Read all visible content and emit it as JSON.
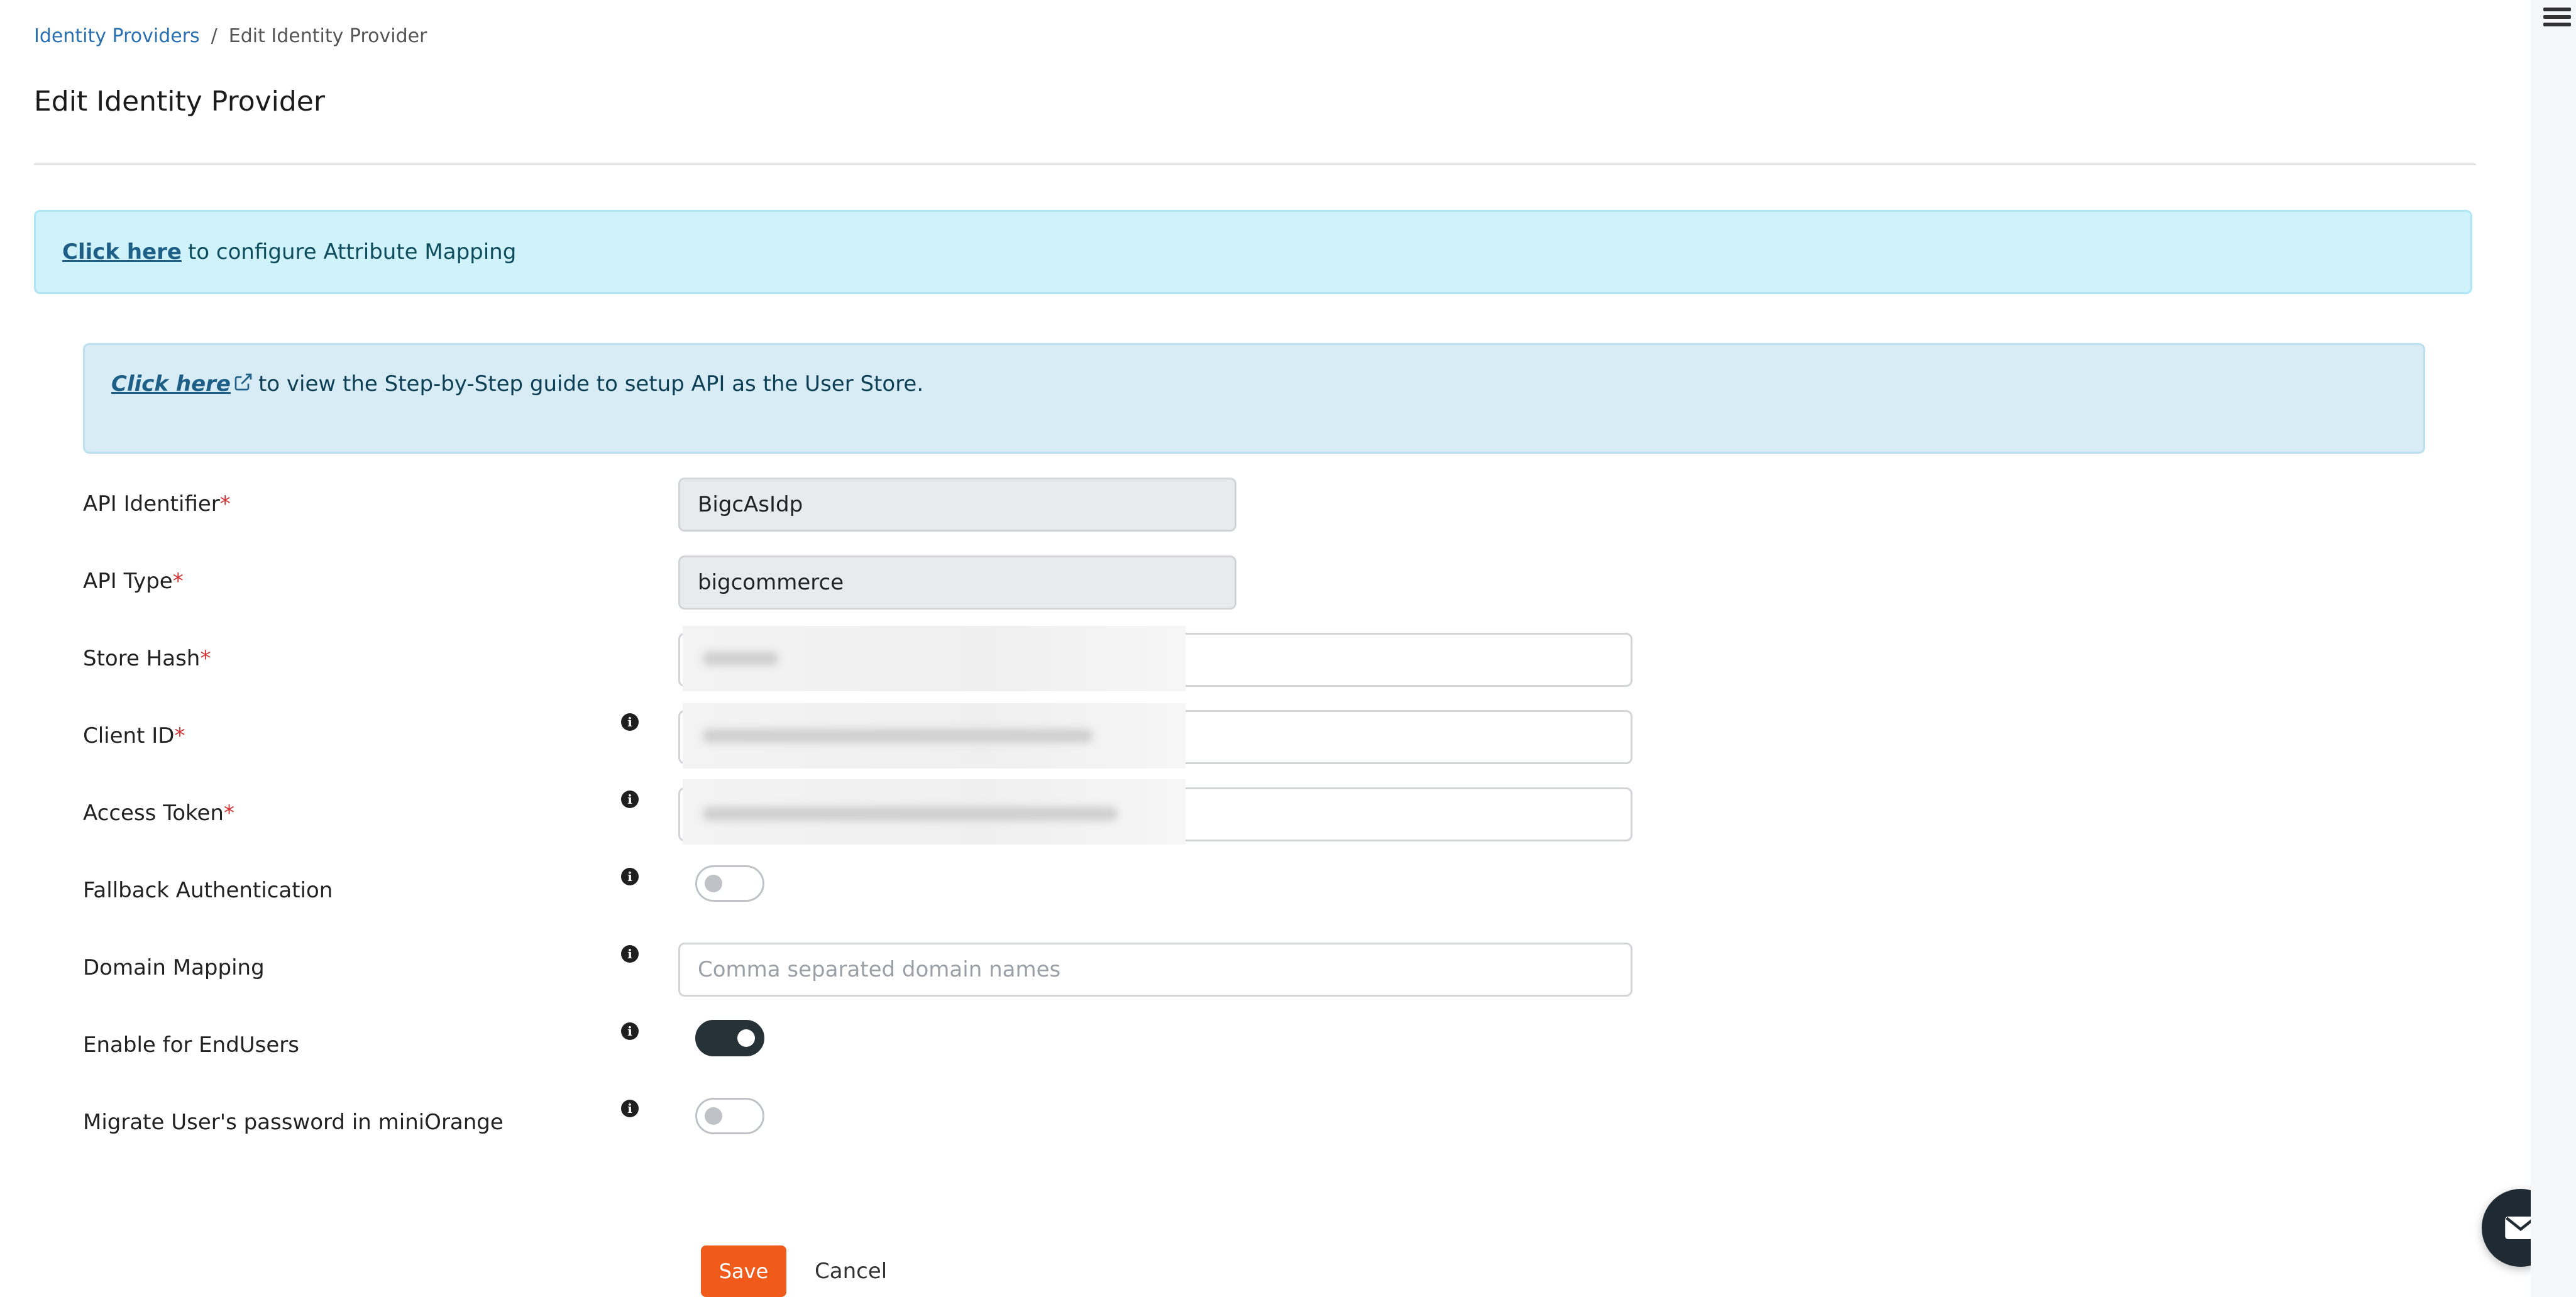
{
  "breadcrumb": {
    "parent": "Identity Providers",
    "separator": "/",
    "current": "Edit Identity Provider"
  },
  "page": {
    "title": "Edit Identity Provider"
  },
  "alerts": {
    "mapping_link": "Click here",
    "mapping_text": "to configure Attribute Mapping",
    "guide_link": "Click here",
    "guide_text": "to view the Step-by-Step guide to setup API as the User Store."
  },
  "form": {
    "required_marker": "*",
    "api_identifier": {
      "label": "API Identifier",
      "value": "BigcAsIdp"
    },
    "api_type": {
      "label": "API Type",
      "value": "bigcommerce"
    },
    "store_hash": {
      "label": "Store Hash"
    },
    "client_id": {
      "label": "Client ID"
    },
    "access_token": {
      "label": "Access Token"
    },
    "fallback_auth": {
      "label": "Fallback Authentication",
      "enabled": false
    },
    "domain_mapping": {
      "label": "Domain Mapping",
      "placeholder": "Comma separated domain names",
      "value": ""
    },
    "enable_endusers": {
      "label": "Enable for EndUsers",
      "enabled": true
    },
    "migrate_password": {
      "label": "Migrate User's password in miniOrange",
      "enabled": false
    },
    "info_glyph": "i"
  },
  "actions": {
    "save_label": "Save",
    "cancel_label": "Cancel"
  },
  "icons": {
    "menu": "hamburger-menu-icon",
    "external_link": "external-link-icon",
    "info": "info-icon",
    "chat": "mail-icon"
  },
  "colors": {
    "primary_button": "#f05a1a",
    "link": "#2a6fb0",
    "info_alert_bg": "#cff2fb",
    "guide_alert_bg": "#d8ecf6",
    "toggle_on": "#263238",
    "required": "#d43434"
  }
}
